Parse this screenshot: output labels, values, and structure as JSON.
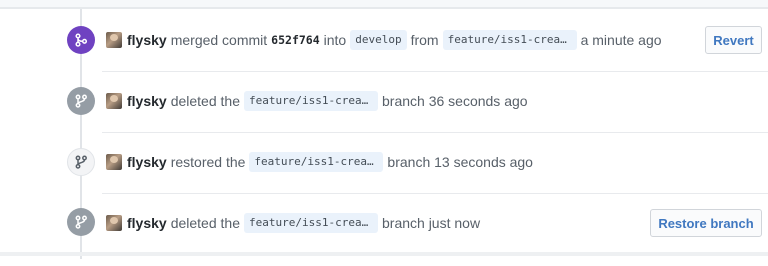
{
  "events": [
    {
      "type": "merged",
      "icon": "git-merge-icon",
      "author": "flysky",
      "verb": "merged commit",
      "sha": "652f764",
      "into_word": "into",
      "base_branch": "develop",
      "from_word": "from",
      "head_branch": "feature/iss1-create…",
      "time": "a minute ago",
      "action_label": "Revert"
    },
    {
      "type": "deleted",
      "icon": "git-branch-icon",
      "author": "flysky",
      "verb": "deleted the",
      "branch": "feature/iss1-create…",
      "suffix": "branch 36 seconds ago"
    },
    {
      "type": "restored",
      "icon": "git-branch-icon",
      "author": "flysky",
      "verb": "restored the",
      "branch": "feature/iss1-create…",
      "suffix": "branch 13 seconds ago"
    },
    {
      "type": "deleted",
      "icon": "git-branch-icon",
      "author": "flysky",
      "verb": "deleted the",
      "branch": "feature/iss1-create…",
      "suffix": "branch just now",
      "action_label": "Restore branch"
    }
  ],
  "colors": {
    "merged_badge": "#6f42c1",
    "deleted_badge": "#959da5",
    "restored_badge": "#f3f4f6",
    "button_text": "#4078c0",
    "branch_chip": "#eaf2fb"
  }
}
